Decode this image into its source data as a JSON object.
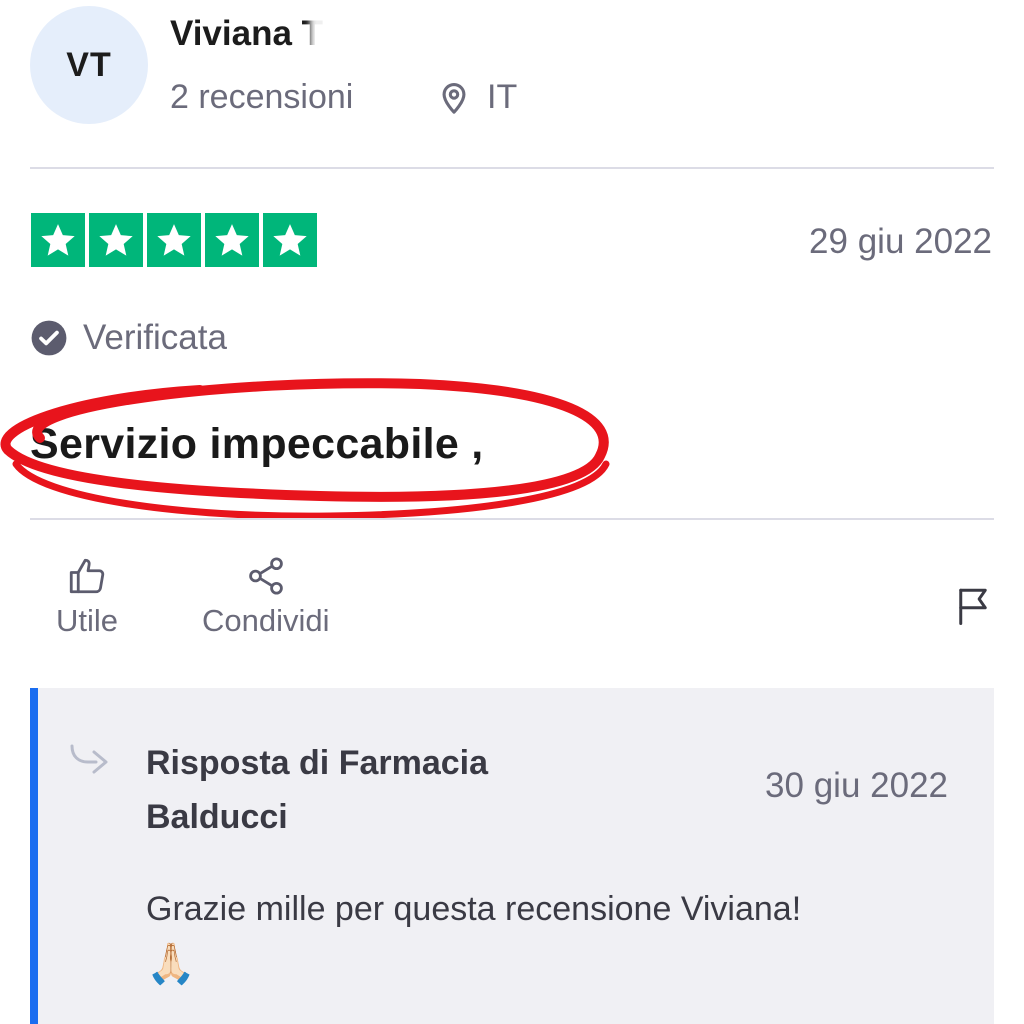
{
  "reviewer": {
    "initials": "VT",
    "name": "Viviana T",
    "review_count": "2 recensioni",
    "country": "IT"
  },
  "review": {
    "rating": 5,
    "date": "29 giu 2022",
    "verified_label": "Verificata",
    "title": "Servizio impeccabile ,"
  },
  "actions": {
    "useful_label": "Utile",
    "share_label": "Condividi"
  },
  "reply": {
    "author": "Risposta di Farmacia Balducci",
    "date": "30 giu 2022",
    "text": "Grazie mille per questa recensione Viviana!",
    "emoji": "🙏🏻"
  },
  "colors": {
    "star_green": "#00b67a",
    "reply_accent": "#1a6df0",
    "marker_red": "#e8141c"
  }
}
